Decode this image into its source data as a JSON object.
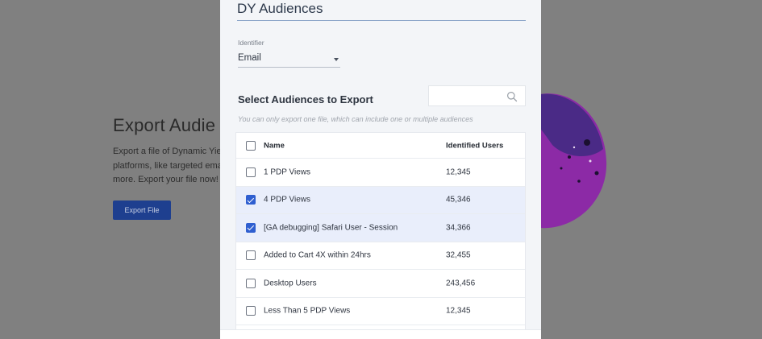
{
  "background": {
    "title": "Export Audie",
    "description_lines": [
      "Export a file of Dynamic Yie",
      "platforms, like targeted ema",
      "more. Export your file now!"
    ],
    "button_label": "Export File"
  },
  "modal": {
    "title": "DY Audiences",
    "identifier": {
      "label": "Identifier",
      "value": "Email"
    },
    "section_title": "Select Audiences to Export",
    "search": {
      "placeholder": ""
    },
    "hint": "You can only export one file, which can include one or multiple audiences",
    "table": {
      "headers": {
        "name": "Name",
        "users": "Identified Users"
      },
      "rows": [
        {
          "name": "1 PDP Views",
          "users": "12,345",
          "checked": false
        },
        {
          "name": "4 PDP Views",
          "users": "45,346",
          "checked": true
        },
        {
          "name": "[GA debugging] Safari User - Session",
          "users": "34,366",
          "checked": true
        },
        {
          "name": "Added to Cart 4X within 24hrs",
          "users": "32,455",
          "checked": false
        },
        {
          "name": "Desktop Users",
          "users": "243,456",
          "checked": false
        },
        {
          "name": "Less Than 5 PDP Views",
          "users": "12,345",
          "checked": false
        }
      ]
    }
  },
  "colors": {
    "accent": "#2f5fd0",
    "button_bg": "#1e3f8f",
    "selected_row": "#e9eefb"
  }
}
